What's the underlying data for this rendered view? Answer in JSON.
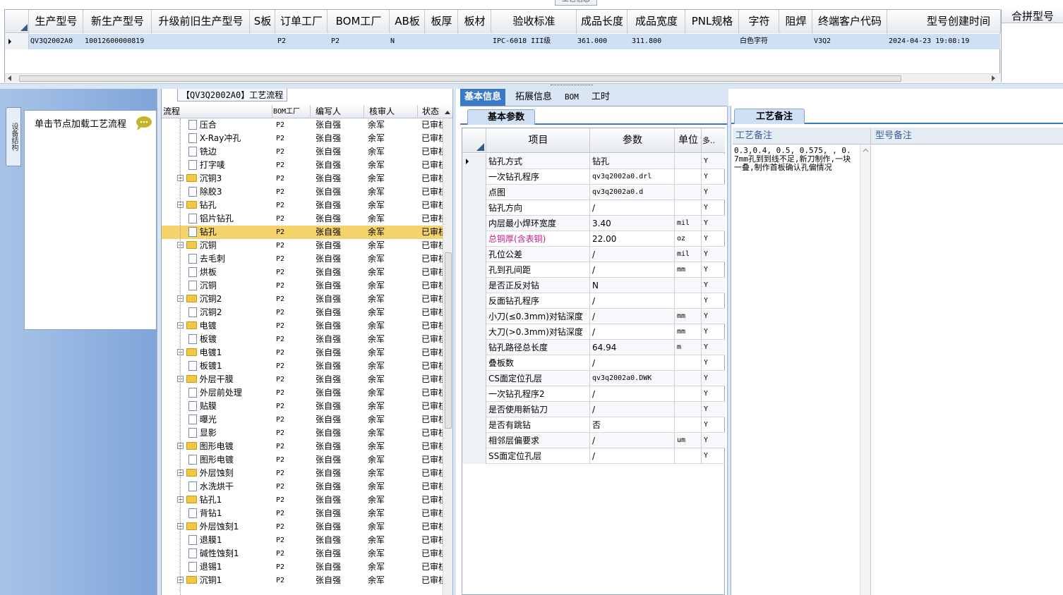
{
  "top_title": "工艺信息",
  "top_table": {
    "headers": [
      "生产型号",
      "新生产型号",
      "升级前旧生产型号",
      "S板",
      "订单工厂",
      "BOM工厂",
      "AB板",
      "板厚",
      "板材",
      "验收标准",
      "成品长度",
      "成品宽度",
      "PNL规格",
      "字符",
      "阻焊",
      "终端客户代码",
      "型号创建时间"
    ],
    "row": [
      "QV3Q2002A0",
      "10012600000819",
      "",
      "",
      "P2",
      "P2",
      "N",
      "",
      "",
      "IPC-6018 III级",
      "361.000",
      "311.800",
      "",
      "白色字符",
      "",
      "V3Q2",
      "2024-04-23 19:08:19"
    ],
    "right_header": "合拼型号"
  },
  "flow_panel": {
    "caption": "【QV3Q2002A0】工艺流程",
    "side_tab": "设备结构",
    "hint": "单击节点加载工艺流程",
    "tree_headers": [
      "流程",
      "BOM工厂",
      "编写人",
      "核审人",
      "状态"
    ],
    "rows": [
      {
        "name": "压合",
        "type": "doc",
        "level": 2,
        "bom": "P2",
        "writer": "张自强",
        "reviewer": "余军",
        "status": "已审核"
      },
      {
        "name": "X-Ray冲孔",
        "type": "doc",
        "level": 2,
        "bom": "P2",
        "writer": "张自强",
        "reviewer": "余军",
        "status": "已审核"
      },
      {
        "name": "铣边",
        "type": "doc",
        "level": 2,
        "bom": "P2",
        "writer": "张自强",
        "reviewer": "余军",
        "status": "已审核"
      },
      {
        "name": "打字唛",
        "type": "doc",
        "level": 2,
        "bom": "P2",
        "writer": "张自强",
        "reviewer": "余军",
        "status": "已审核"
      },
      {
        "name": "沉铜3",
        "type": "folder",
        "level": 1,
        "bom": "P2",
        "writer": "张自强",
        "reviewer": "余军",
        "status": "已审核"
      },
      {
        "name": "除胶3",
        "type": "doc",
        "level": 2,
        "bom": "P2",
        "writer": "张自强",
        "reviewer": "余军",
        "status": "已审核"
      },
      {
        "name": "钻孔",
        "type": "folder",
        "level": 1,
        "bom": "P2",
        "writer": "张自强",
        "reviewer": "余军",
        "status": "已审核"
      },
      {
        "name": "铝片钻孔",
        "type": "doc",
        "level": 2,
        "bom": "P2",
        "writer": "张自强",
        "reviewer": "余军",
        "status": "已审核"
      },
      {
        "name": "钻孔",
        "type": "doc",
        "level": 2,
        "bom": "P2",
        "writer": "张自强",
        "reviewer": "余军",
        "status": "已审核",
        "selected": true
      },
      {
        "name": "沉铜",
        "type": "folder",
        "level": 1,
        "bom": "P2",
        "writer": "张自强",
        "reviewer": "余军",
        "status": "已审核"
      },
      {
        "name": "去毛刺",
        "type": "doc",
        "level": 2,
        "bom": "P2",
        "writer": "张自强",
        "reviewer": "余军",
        "status": "已审核"
      },
      {
        "name": "烘板",
        "type": "doc",
        "level": 2,
        "bom": "P2",
        "writer": "张自强",
        "reviewer": "余军",
        "status": "已审核"
      },
      {
        "name": "沉铜",
        "type": "doc",
        "level": 2,
        "bom": "P2",
        "writer": "张自强",
        "reviewer": "余军",
        "status": "已审核"
      },
      {
        "name": "沉铜2",
        "type": "folder",
        "level": 1,
        "bom": "P2",
        "writer": "张自强",
        "reviewer": "余军",
        "status": "已审核"
      },
      {
        "name": "沉铜2",
        "type": "doc",
        "level": 2,
        "bom": "P2",
        "writer": "张自强",
        "reviewer": "余军",
        "status": "已审核"
      },
      {
        "name": "电镀",
        "type": "folder",
        "level": 1,
        "bom": "P2",
        "writer": "张自强",
        "reviewer": "余军",
        "status": "已审核"
      },
      {
        "name": "板镀",
        "type": "doc",
        "level": 2,
        "bom": "P2",
        "writer": "张自强",
        "reviewer": "余军",
        "status": "已审核"
      },
      {
        "name": "电镀1",
        "type": "folder",
        "level": 1,
        "bom": "P2",
        "writer": "张自强",
        "reviewer": "余军",
        "status": "已审核"
      },
      {
        "name": "板镀1",
        "type": "doc",
        "level": 2,
        "bom": "P2",
        "writer": "张自强",
        "reviewer": "余军",
        "status": "已审核"
      },
      {
        "name": "外层干膜",
        "type": "folder",
        "level": 1,
        "bom": "P2",
        "writer": "张自强",
        "reviewer": "余军",
        "status": "已审核"
      },
      {
        "name": "外层前处理",
        "type": "doc",
        "level": 2,
        "bom": "P2",
        "writer": "张自强",
        "reviewer": "余军",
        "status": "已审核"
      },
      {
        "name": "贴膜",
        "type": "doc",
        "level": 2,
        "bom": "P2",
        "writer": "张自强",
        "reviewer": "余军",
        "status": "已审核"
      },
      {
        "name": "曝光",
        "type": "doc",
        "level": 2,
        "bom": "P2",
        "writer": "张自强",
        "reviewer": "余军",
        "status": "已审核"
      },
      {
        "name": "显影",
        "type": "doc",
        "level": 2,
        "bom": "P2",
        "writer": "张自强",
        "reviewer": "余军",
        "status": "已审核"
      },
      {
        "name": "图形电镀",
        "type": "folder",
        "level": 1,
        "bom": "P2",
        "writer": "张自强",
        "reviewer": "余军",
        "status": "已审核"
      },
      {
        "name": "图形电镀",
        "type": "doc",
        "level": 2,
        "bom": "P2",
        "writer": "张自强",
        "reviewer": "余军",
        "status": "已审核"
      },
      {
        "name": "外层蚀刻",
        "type": "folder",
        "level": 1,
        "bom": "P2",
        "writer": "张自强",
        "reviewer": "余军",
        "status": "已审核"
      },
      {
        "name": "水洗烘干",
        "type": "doc",
        "level": 2,
        "bom": "P2",
        "writer": "张自强",
        "reviewer": "余军",
        "status": "已审核"
      },
      {
        "name": "钻孔1",
        "type": "folder",
        "level": 1,
        "bom": "P2",
        "writer": "张自强",
        "reviewer": "余军",
        "status": "已审核"
      },
      {
        "name": "背钻1",
        "type": "doc",
        "level": 2,
        "bom": "P2",
        "writer": "张自强",
        "reviewer": "余军",
        "status": "已审核"
      },
      {
        "name": "外层蚀刻1",
        "type": "folder",
        "level": 1,
        "bom": "P2",
        "writer": "张自强",
        "reviewer": "余军",
        "status": "已审核"
      },
      {
        "name": "退膜1",
        "type": "doc",
        "level": 2,
        "bom": "P2",
        "writer": "张自强",
        "reviewer": "余军",
        "status": "已审核"
      },
      {
        "name": "碱性蚀刻1",
        "type": "doc",
        "level": 2,
        "bom": "P2",
        "writer": "张自强",
        "reviewer": "余军",
        "status": "已审核"
      },
      {
        "name": "退锡1",
        "type": "doc",
        "level": 2,
        "bom": "P2",
        "writer": "张自强",
        "reviewer": "余军",
        "status": "已审核"
      },
      {
        "name": "沉铜1",
        "type": "folder",
        "level": 1,
        "bom": "P2",
        "writer": "张自强",
        "reviewer": "余军",
        "status": "已审核"
      }
    ]
  },
  "info_tabs": [
    "基本信息",
    "拓展信息",
    "BOM",
    "工时"
  ],
  "basic_params": {
    "subtab": "基本参数",
    "headers": [
      "项目",
      "参数",
      "单位",
      "多.."
    ],
    "rows": [
      {
        "item": "钻孔方式",
        "param": "钻孔",
        "unit": "",
        "flag": "Y"
      },
      {
        "item": "一次钻孔程序",
        "param": "qv3q2002a0.drl",
        "unit": "",
        "flag": "Y"
      },
      {
        "item": "点图",
        "param": "qv3q2002a0.d",
        "unit": "",
        "flag": "Y"
      },
      {
        "item": "钻孔方向",
        "param": "/",
        "unit": "",
        "flag": "Y"
      },
      {
        "item": "内层最小焊环宽度",
        "param": "3.40",
        "unit": "mil",
        "flag": "Y"
      },
      {
        "item": "总铜厚(含表铜)",
        "param": "22.00",
        "unit": "oz",
        "flag": "Y",
        "highlight": true
      },
      {
        "item": "孔位公差",
        "param": "/",
        "unit": "mil",
        "flag": "Y"
      },
      {
        "item": "孔到孔间距",
        "param": "/",
        "unit": "mm",
        "flag": "Y"
      },
      {
        "item": "是否正反对钻",
        "param": "N",
        "unit": "",
        "flag": "Y"
      },
      {
        "item": "反面钻孔程序",
        "param": "/",
        "unit": "",
        "flag": "Y"
      },
      {
        "item": "小刀(≤0.3mm)对钻深度",
        "param": "/",
        "unit": "mm",
        "flag": "Y"
      },
      {
        "item": "大刀(>0.3mm)对钻深度",
        "param": "/",
        "unit": "mm",
        "flag": "Y"
      },
      {
        "item": "钻孔路径总长度",
        "param": "64.94",
        "unit": "m",
        "flag": "Y"
      },
      {
        "item": "叠板数",
        "param": "/",
        "unit": "",
        "flag": "Y"
      },
      {
        "item": "CS面定位孔层",
        "param": "qv3q2002a0.DWK",
        "unit": "",
        "flag": "Y"
      },
      {
        "item": "一次钻孔程序2",
        "param": "/",
        "unit": "",
        "flag": "Y"
      },
      {
        "item": "是否使用新钻刀",
        "param": "/",
        "unit": "",
        "flag": "Y"
      },
      {
        "item": "是否有跳钻",
        "param": "否",
        "unit": "",
        "flag": "Y"
      },
      {
        "item": "相邻层偏要求",
        "param": "/",
        "unit": "um",
        "flag": "Y"
      },
      {
        "item": "SS面定位孔层",
        "param": "/",
        "unit": "",
        "flag": "Y"
      }
    ]
  },
  "remarks": {
    "tab": "工艺备注",
    "col1": "工艺备注",
    "col2": "型号备注",
    "text": "0.3,0.4, 0.5, 0.575, , 0.7mm孔到到线不足,新刀制作,一块一叠,制作首板确认孔偏情况"
  },
  "colors": {
    "accent": "#3a78c8",
    "selected_row": "#f6d36a",
    "header_blue": "#cfe0f5",
    "sidebar": "#8fb1e0"
  }
}
